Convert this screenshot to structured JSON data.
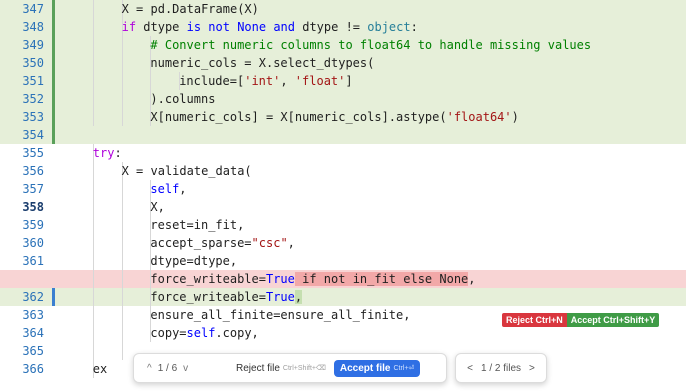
{
  "lines": [
    {
      "num": "347",
      "type": "added",
      "indent": 3,
      "tokens": [
        {
          "t": "X = pd.DataFrame(X)"
        }
      ]
    },
    {
      "num": "348",
      "type": "added",
      "indent": 3,
      "tokens": [
        {
          "t": "if",
          "c": "kw2"
        },
        {
          "t": " dtype "
        },
        {
          "t": "is not None and",
          "c": "kw"
        },
        {
          "t": " dtype != "
        },
        {
          "t": "object",
          "c": "obj"
        },
        {
          "t": ":"
        }
      ]
    },
    {
      "num": "349",
      "type": "added",
      "indent": 4,
      "tokens": [
        {
          "t": "# Convert numeric columns to float64 to handle missing values",
          "c": "cm"
        }
      ]
    },
    {
      "num": "350",
      "type": "added",
      "indent": 4,
      "tokens": [
        {
          "t": "numeric_cols = X.select_dtypes("
        }
      ]
    },
    {
      "num": "351",
      "type": "added",
      "indent": 5,
      "tokens": [
        {
          "t": "include=["
        },
        {
          "t": "'int'",
          "c": "str"
        },
        {
          "t": ", "
        },
        {
          "t": "'float'",
          "c": "str"
        },
        {
          "t": "]"
        }
      ]
    },
    {
      "num": "352",
      "type": "added",
      "indent": 4,
      "tokens": [
        {
          "t": ").columns"
        }
      ]
    },
    {
      "num": "353",
      "type": "added",
      "indent": 4,
      "tokens": [
        {
          "t": "X[numeric_cols] = X[numeric_cols].astype("
        },
        {
          "t": "'float64'",
          "c": "str"
        },
        {
          "t": ")"
        }
      ]
    },
    {
      "num": "354",
      "type": "added",
      "indent": 0,
      "tokens": []
    },
    {
      "num": "355",
      "type": "normal",
      "indent": 2,
      "tokens": [
        {
          "t": "try",
          "c": "kw2"
        },
        {
          "t": ":"
        }
      ]
    },
    {
      "num": "356",
      "type": "normal",
      "indent": 3,
      "tokens": [
        {
          "t": "X = validate_data("
        }
      ]
    },
    {
      "num": "357",
      "type": "normal",
      "indent": 4,
      "tokens": [
        {
          "t": "self",
          "c": "self"
        },
        {
          "t": ","
        }
      ]
    },
    {
      "num": "358",
      "type": "current",
      "indent": 4,
      "tokens": [
        {
          "t": "X,"
        }
      ]
    },
    {
      "num": "359",
      "type": "normal",
      "indent": 4,
      "tokens": [
        {
          "t": "reset=in_fit,"
        }
      ]
    },
    {
      "num": "360",
      "type": "normal",
      "indent": 4,
      "tokens": [
        {
          "t": "accept_sparse="
        },
        {
          "t": "\"csc\"",
          "c": "str"
        },
        {
          "t": ","
        }
      ]
    },
    {
      "num": "361",
      "type": "normal",
      "indent": 4,
      "tokens": [
        {
          "t": "dtype=dtype,"
        }
      ]
    },
    {
      "num": "",
      "type": "deleted",
      "indent": 4,
      "tokens": [
        {
          "t": "force_writeable="
        },
        {
          "t": "True",
          "c": "kw"
        },
        {
          "t": " if not in_fit else None",
          "c": "delhl"
        },
        {
          "t": ","
        }
      ]
    },
    {
      "num": "362",
      "type": "added",
      "indent": 4,
      "marker": "mod",
      "tokens": [
        {
          "t": "force_writeable="
        },
        {
          "t": "True",
          "c": "kw"
        },
        {
          "t": ",",
          "c": "addhl"
        }
      ]
    },
    {
      "num": "363",
      "type": "normal",
      "indent": 4,
      "tokens": [
        {
          "t": "ensure_all_finite=ensure_all_finite,"
        }
      ]
    },
    {
      "num": "364",
      "type": "normal",
      "indent": 4,
      "tokens": [
        {
          "t": "copy="
        },
        {
          "t": "self",
          "c": "self"
        },
        {
          "t": ".copy,"
        }
      ]
    },
    {
      "num": "365",
      "type": "normal",
      "indent": 3,
      "tokens": []
    },
    {
      "num": "366",
      "type": "normal",
      "indent": 2,
      "tokens": [
        {
          "t": "ex"
        }
      ]
    }
  ],
  "inline_actions": {
    "reject_label": "Reject Ctrl+N",
    "accept_label": "Accept Ctrl+Shift+Y"
  },
  "review_bar": {
    "prev_arrow": "^",
    "change_counter": "1 / 6",
    "next_arrow": "v",
    "reject_file_label": "Reject file",
    "reject_file_shortcut": "Ctrl+Shift+⌫",
    "accept_file_label": "Accept file",
    "accept_file_shortcut": "Ctrl+⏎",
    "files_prev": "<",
    "files_counter": "1 / 2 files",
    "files_next": ">"
  },
  "colors": {
    "added_bg": "#e6efd9",
    "deleted_bg": "#f8d4d4",
    "accept_blue": "#2f6fe4",
    "reject_red": "#d9363e",
    "accept_green": "#3f9b46"
  }
}
